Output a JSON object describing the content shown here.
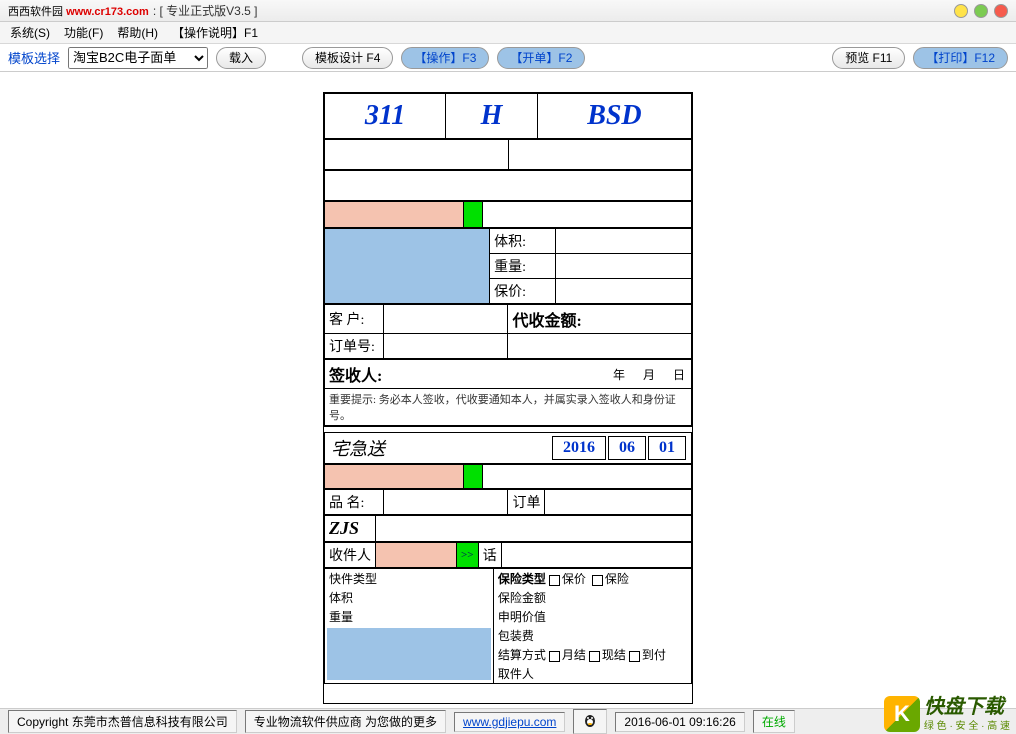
{
  "titlebar": {
    "logo_prefix": "西西软件园",
    "logo_url": "www.cr173.com",
    "title": ": [ 专业正式版V3.5 ]"
  },
  "menubar": {
    "system": "系统(S)",
    "function": "功能(F)",
    "help": "帮助(H)",
    "instructions": "【操作说明】F1"
  },
  "toolbar": {
    "template_label": "模板选择",
    "template_value": "淘宝B2C电子面单",
    "load": "载入",
    "design": "模板设计 F4",
    "operate": "【操作】F3",
    "open": "【开单】F2",
    "preview": "预览 F11",
    "print": "【打印】F12"
  },
  "form": {
    "big1": "311",
    "big2": "H",
    "big3": "BSD",
    "volume": "体积:",
    "weight": "重量:",
    "insure": "保价:",
    "customer": "客  户:",
    "cod": "代收金额:",
    "orderno": "订单号:",
    "signer": "签收人:",
    "year": "年",
    "month": "月",
    "day": "日",
    "tip": "重要提示:  务必本人签收，代收要通知本人，并属实录入签收人和身份证号。",
    "express": "宅急送",
    "date_y": "2016",
    "date_m": "06",
    "date_d": "01",
    "product": "品    名:",
    "order2": "订单",
    "zjs": "ZJS",
    "recipient": "收件人",
    "phone": "话",
    "arrow": ">>",
    "express_type": "快件类型",
    "volume2": "体积",
    "weight2": "重量",
    "insurance_type": "保险类型",
    "insure_value": "保价",
    "insure_checkbox": "保险",
    "insurance_amount": "保险金额",
    "declare_value": "申明价值",
    "pack_fee": "包装费",
    "settle": "结算方式",
    "monthly": "月结",
    "cash": "现结",
    "cod2": "到付",
    "pickup": "取件人"
  },
  "statusbar": {
    "copyright": "Copyright 东莞市杰普信息科技有限公司",
    "supplier": "专业物流软件供应商   为您做的更多",
    "url": "www.gdjiepu.com",
    "datetime": "2016-06-01 09:16:26",
    "online": "在线"
  },
  "watermark": {
    "text": "快盘下载",
    "sub": "绿 色 · 安 全 · 高 速"
  }
}
